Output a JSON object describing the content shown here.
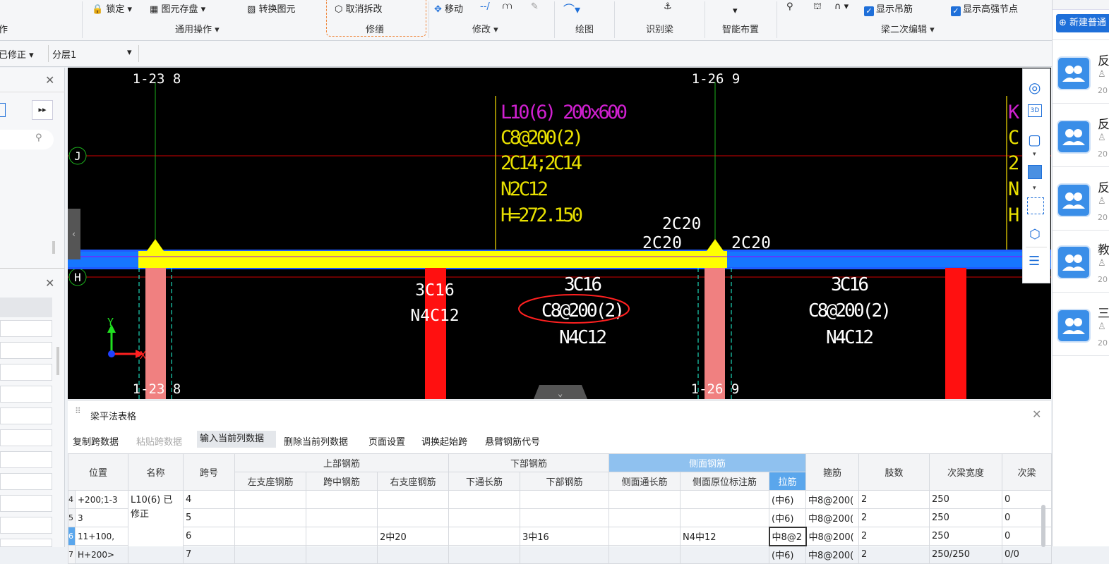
{
  "ribbon": {
    "lock": "锁定",
    "store": "图元存盘",
    "convert": "转换图元",
    "cancel_split": "取消拆改",
    "move": "移动",
    "general_ops": "通用操作",
    "repair": "修缮",
    "modify": "修改",
    "draw": "绘图",
    "identify_beam": "识别梁",
    "smart_layout": "智能布置",
    "beam_second_edit": "梁二次编辑",
    "show_hanger": "显示吊筋",
    "show_strong_node": "显示高强节点",
    "left_cut": "作"
  },
  "secbar": {
    "status": "已修正",
    "layer": "分层1"
  },
  "canvas": {
    "axis_top_left": "1-23 8",
    "axis_top_right": "1-26 9",
    "axis_bottom_left": "1-23 8",
    "axis_bottom_right": "1-26 9",
    "axis_J": "J",
    "axis_H": "H",
    "beam_annotation": [
      "L10(6) 200x600",
      "C8@200(2)",
      "2C14;2C14",
      "N2C12",
      "H=272.150"
    ],
    "support_top": "2C20",
    "support_left": "2C20",
    "support_right": "2C20",
    "span1": [
      "3C16",
      "N4C12"
    ],
    "span2": [
      "3C16",
      "C8@200(2)",
      "N4C12"
    ],
    "span3": [
      "3C16",
      "C8@200(2)",
      "N4C12"
    ],
    "ucs_y": "Y",
    "ucs_x": "X"
  },
  "table": {
    "title": "梁平法表格",
    "toolbar": [
      "复制跨数据",
      "粘贴跨数据",
      "输入当前列数据",
      "删除当前列数据",
      "页面设置",
      "调换起始跨",
      "悬臂钢筋代号"
    ],
    "group_headers": {
      "top": "上部钢筋",
      "bottom": "下部钢筋",
      "side": "侧面钢筋"
    },
    "columns": {
      "position": "位置",
      "name": "名称",
      "span": "跨号",
      "left_support": "左支座钢筋",
      "mid": "跨中钢筋",
      "right_support": "右支座钢筋",
      "bottom_through": "下通长筋",
      "bottom_bar": "下部钢筋",
      "side_through": "侧面通长筋",
      "side_orig": "侧面原位标注筋",
      "tie": "拉筋",
      "stirrup": "箍筋",
      "legs": "肢数",
      "beam_width": "次梁宽度",
      "beam_extra": "次梁"
    },
    "rows": [
      {
        "idx": "4",
        "pos": "+200;1-3",
        "span": "4",
        "right": "",
        "bottom": "",
        "side_orig": "",
        "tie": "(中6)",
        "stirrup": "中8@200(",
        "legs": "2",
        "width": "250",
        "extra": "0"
      },
      {
        "idx": "5",
        "pos": "3",
        "span": "5",
        "right": "",
        "bottom": "",
        "side_orig": "",
        "tie": "(中6)",
        "stirrup": "中8@200(",
        "legs": "2",
        "width": "250",
        "extra": "0"
      },
      {
        "idx": "6",
        "pos": "11+100,",
        "span": "6",
        "right": "2中20",
        "bottom": "3中16",
        "side_orig": "N4中12",
        "tie": "中8@2",
        "stirrup": "中8@200(",
        "legs": "2",
        "width": "250",
        "extra": "0"
      },
      {
        "idx": "7",
        "pos": "H+200>",
        "span": "7",
        "right": "",
        "bottom": "",
        "side_orig": "",
        "tie": "(中6)",
        "stirrup": "中8@200(",
        "legs": "2",
        "width": "250/250",
        "extra": "0/0"
      }
    ],
    "name_cell": "L10(6) 已修正"
  },
  "right": {
    "new_button": "新建普通",
    "items": [
      {
        "t": "反",
        "d": "20"
      },
      {
        "t": "反",
        "d": "20"
      },
      {
        "t": "反",
        "d": "20"
      },
      {
        "t": "教",
        "d": "20"
      },
      {
        "t": "三",
        "d": "20"
      }
    ]
  }
}
